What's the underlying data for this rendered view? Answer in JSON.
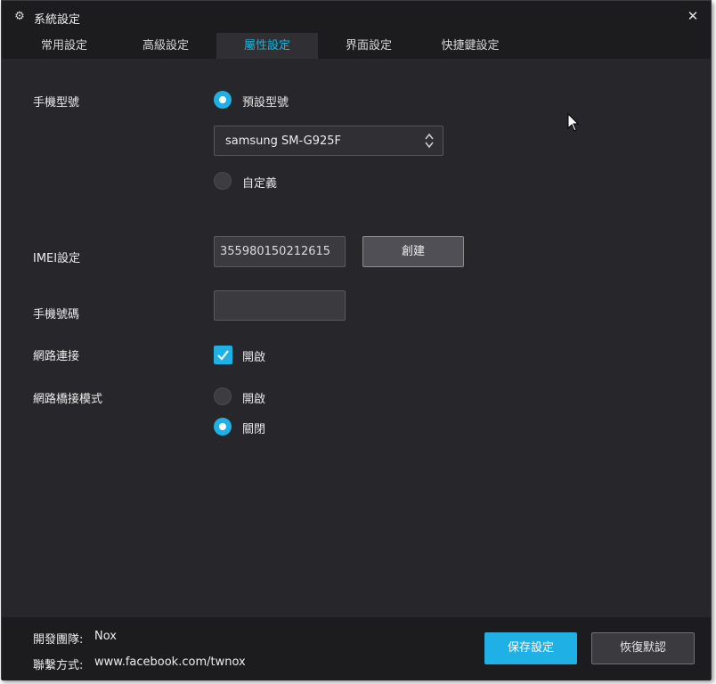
{
  "window": {
    "title": "系統設定",
    "icon": "gear-icon",
    "close_icon": "close-icon"
  },
  "tabs": [
    {
      "label": "常用設定",
      "active": false
    },
    {
      "label": "高級設定",
      "active": false
    },
    {
      "label": "屬性設定",
      "active": true
    },
    {
      "label": "界面設定",
      "active": false
    },
    {
      "label": "快捷鍵設定",
      "active": false
    }
  ],
  "phone_model": {
    "label": "手機型號",
    "preset_option": "預設型號",
    "preset_selected": true,
    "model_value": "samsung SM-G925F",
    "custom_option": "自定義",
    "custom_selected": false
  },
  "imei": {
    "label": "IMEI設定",
    "value": "355980150212615",
    "create_button": "創建"
  },
  "phone_number": {
    "label": "手機號碼",
    "value": ""
  },
  "network": {
    "label": "網路連接",
    "option": "開啟",
    "checked": true
  },
  "bridge_mode": {
    "label": "網路橋接模式",
    "on_option": "開啟",
    "on_selected": false,
    "off_option": "關閉",
    "off_selected": true
  },
  "footer": {
    "team_label": "開發團隊:",
    "team_value": "Nox",
    "contact_label": "聯繫方式:",
    "contact_value": "www.facebook.com/twnox",
    "save_button": "保存設定",
    "restore_button": "恢復默認"
  },
  "colors": {
    "accent": "#1fb1e5",
    "background": "#27272b",
    "bar": "#1c1c1f"
  }
}
